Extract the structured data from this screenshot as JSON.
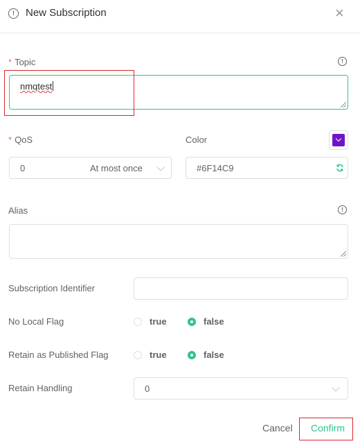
{
  "dialog": {
    "title": "New Subscription",
    "info_glyph": "!",
    "close_glyph": "×"
  },
  "topic": {
    "required_mark": "*",
    "label": "Topic",
    "value": "nmqtest"
  },
  "qos": {
    "required_mark": "*",
    "label": "QoS",
    "value": "0",
    "option_text": "At most once"
  },
  "color": {
    "label": "Color",
    "value": "#6F14C9",
    "swatch": "#6F14C9",
    "refresh_icon": "refresh-icon"
  },
  "alias": {
    "label": "Alias",
    "value": ""
  },
  "subscription_identifier": {
    "label": "Subscription Identifier",
    "value": ""
  },
  "no_local_flag": {
    "label": "No Local Flag",
    "options": [
      "true",
      "false"
    ],
    "selected": "false"
  },
  "retain_as_published": {
    "label": "Retain as Published Flag",
    "options": [
      "true",
      "false"
    ],
    "selected": "false"
  },
  "retain_handling": {
    "label": "Retain Handling",
    "value": "0"
  },
  "footer": {
    "cancel_label": "Cancel",
    "confirm_label": "Confirm"
  },
  "colors": {
    "accent": "#34c388",
    "required": "#f56c6c",
    "highlight_box": "#d9262b"
  }
}
